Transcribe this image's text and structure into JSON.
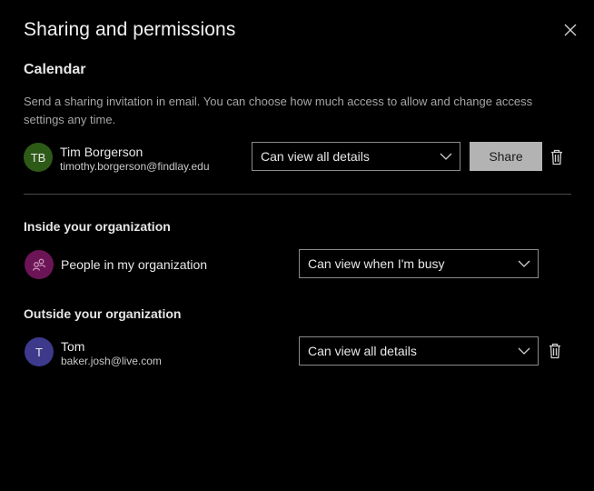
{
  "dialog": {
    "title": "Sharing and permissions"
  },
  "calendar": {
    "heading": "Calendar",
    "description": "Send a sharing invitation in email. You can choose how much access to allow and change access settings any time.",
    "invite": {
      "initials": "TB",
      "name": "Tim Borgerson",
      "email": "timothy.borgerson@findlay.edu",
      "permission": "Can view all details",
      "share_label": "Share"
    }
  },
  "inside": {
    "heading": "Inside your organization",
    "entity_name": "People in my organization",
    "permission": "Can view when I'm busy"
  },
  "outside": {
    "heading": "Outside your organization",
    "person": {
      "initials": "T",
      "name": "Tom",
      "email": "baker.josh@live.com",
      "permission": "Can view all details"
    }
  },
  "colors": {
    "background": "#000000",
    "avatar_tb": "#2e5a17",
    "avatar_org": "#6c1556",
    "avatar_tom": "#3d3a8c",
    "share_button": "#b3b3b3"
  },
  "icons": [
    "close-icon",
    "chevron-down-icon",
    "trash-icon",
    "people-group-icon"
  ]
}
